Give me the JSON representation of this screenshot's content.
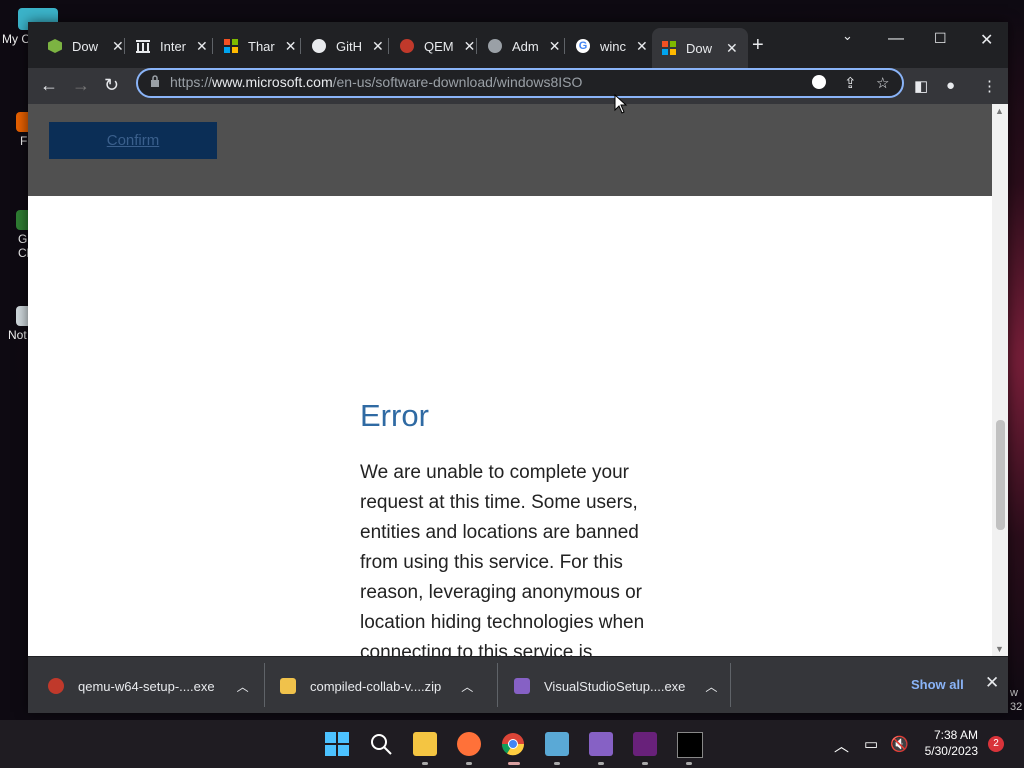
{
  "desktop": {
    "icons": [
      {
        "label": "My C"
      },
      {
        "label": "F"
      },
      {
        "label": "G\nCl"
      },
      {
        "label": "Not"
      }
    ],
    "edge_text": [
      "w",
      "32"
    ]
  },
  "browser": {
    "tabs": [
      {
        "label": "Dow",
        "icon": "package-icon",
        "color": "#7cb342"
      },
      {
        "label": "Inter",
        "icon": "archive-icon",
        "color": "#e8eaed"
      },
      {
        "label": "Thar",
        "icon": "microsoft-icon",
        "color": "#f25022"
      },
      {
        "label": "GitH",
        "icon": "github-icon",
        "color": "#e8eaed"
      },
      {
        "label": "QEM",
        "icon": "qemu-icon",
        "color": "#d9534f"
      },
      {
        "label": "Adm",
        "icon": "globe-icon",
        "color": "#9aa0a6"
      },
      {
        "label": "winc",
        "icon": "google-icon",
        "color": "#4285f4"
      },
      {
        "label": "Dow",
        "icon": "microsoft-icon",
        "color": "#f25022",
        "active": true
      }
    ],
    "address": {
      "prefix": "https://",
      "host": "www.microsoft.com",
      "path": "/en-us/software-download/windows8ISO"
    },
    "page": {
      "confirm_label": "Confirm",
      "error_title": "Error",
      "error_body": "We are unable to complete your request at this time. Some users, entities and locations are banned from using this service. For this reason, leveraging anonymous or location hiding technologies when connecting to this service is"
    },
    "downloads": [
      {
        "name": "qemu-w64-setup-....exe",
        "icon": "qemu-file-icon"
      },
      {
        "name": "compiled-collab-v....zip",
        "icon": "zip-folder-icon"
      },
      {
        "name": "VisualStudioSetup....exe",
        "icon": "visual-studio-icon"
      }
    ],
    "show_all_label": "Show all"
  },
  "taskbar": {
    "time": "7:38 AM",
    "date": "5/30/2023",
    "notification_count": "2"
  }
}
